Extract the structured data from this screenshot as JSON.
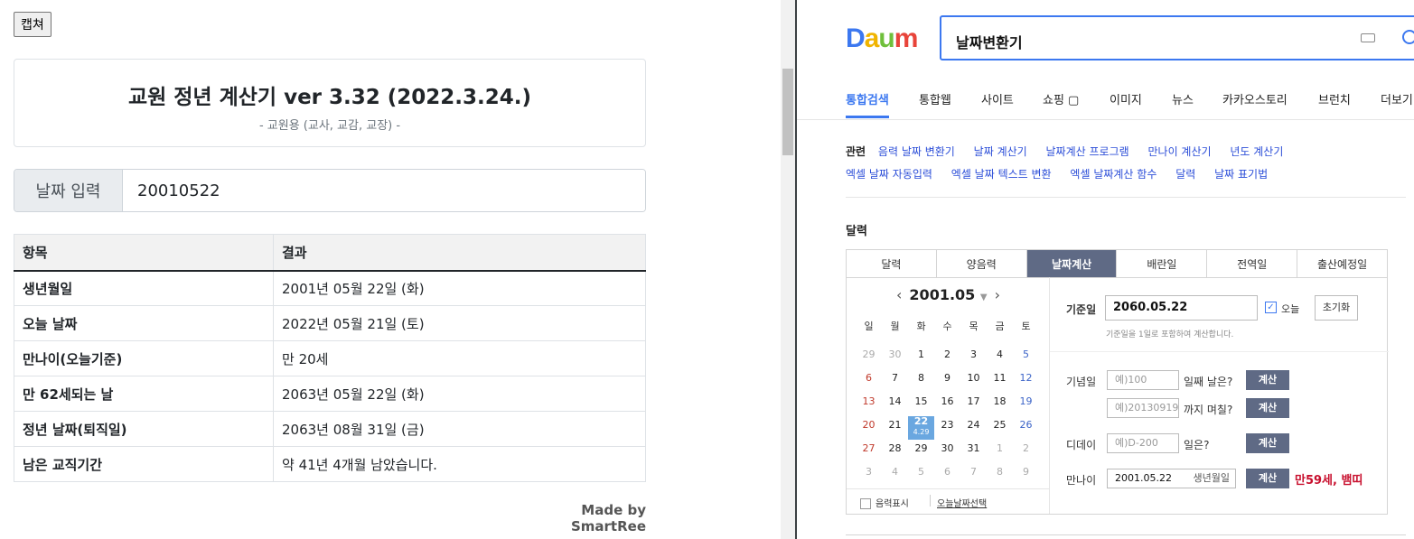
{
  "left": {
    "capture_button": "캡쳐",
    "title": "교원 정년 계산기 ver 3.32 (2022.3.24.)",
    "subtitle": "- 교원용 (교사, 교감, 교장) -",
    "date_input_label": "날짜 입력",
    "date_input_value": "20010522",
    "table_headers": [
      "항목",
      "결과"
    ],
    "rows": [
      [
        "생년월일",
        "2001년 05월 22일 (화)"
      ],
      [
        "오늘 날짜",
        "2022년 05월 21일 (토)"
      ],
      [
        "만나이(오늘기준)",
        "만 20세"
      ],
      [
        "만 62세되는 날",
        "2063년 05월 22일 (화)"
      ],
      [
        "정년 날짜(퇴직일)",
        "2063년 08월 31일 (금)"
      ],
      [
        "남은 교직기간",
        "약 41년 4개월 남았습니다."
      ]
    ],
    "made_by": "Made by SmartRee"
  },
  "right": {
    "logo": "Daum",
    "search_query": "날짜변환기",
    "tabs": [
      "통합검색",
      "통합웹",
      "사이트",
      "쇼핑 ▢",
      "이미지",
      "뉴스",
      "카카오스토리",
      "브런치",
      "더보기"
    ],
    "related_label": "관련",
    "related_links": [
      "음력 날짜 변환기",
      "날짜 계산기",
      "날짜계산 프로그램",
      "만나이 계산기",
      "년도 계산기",
      "엑셀 날짜 자동입력",
      "엑셀 날짜 텍스트 변환",
      "엑셀 날짜계산 함수",
      "달력",
      "날짜 표기법"
    ],
    "calendar_title": "달력",
    "cal_tabs": [
      "달력",
      "양음력",
      "날짜계산",
      "배란일",
      "전역일",
      "출산예정일"
    ],
    "month": "2001.05",
    "weekdays": [
      "일",
      "월",
      "화",
      "수",
      "목",
      "금",
      "토"
    ],
    "weeks": [
      [
        "29",
        "30",
        "1",
        "2",
        "3",
        "4",
        "5"
      ],
      [
        "6",
        "7",
        "8",
        "9",
        "10",
        "11",
        "12"
      ],
      [
        "13",
        "14",
        "15",
        "16",
        "17",
        "18",
        "19"
      ],
      [
        "20",
        "21",
        "22",
        "23",
        "24",
        "25",
        "26"
      ],
      [
        "27",
        "28",
        "29",
        "30",
        "31",
        "1",
        "2"
      ],
      [
        "3",
        "4",
        "5",
        "6",
        "7",
        "8",
        "9"
      ]
    ],
    "today_lunar": "4.29",
    "lunar_toggle": "음력표시",
    "today_select": "오늘날짜선택",
    "base_label": "기준일",
    "base_value": "2060.05.22",
    "today_check": "오늘",
    "reset_button": "초기화",
    "base_note": "기준일을 1일로 포함하여 계산합니다.",
    "anniv_label": "기념일",
    "anniv_placeholder": "예)100",
    "anniv_suffix": "일째 날은?",
    "until_placeholder": "예)20130919",
    "until_suffix": "까지 며칠?",
    "dday_label": "디데이",
    "dday_placeholder": "예)D-200",
    "dday_suffix": "일은?",
    "age_label": "만나이",
    "age_value": "2001.05.22",
    "age_hint": "생년월일",
    "calc_button": "계산",
    "age_result": "만59세, 뱀띠"
  }
}
